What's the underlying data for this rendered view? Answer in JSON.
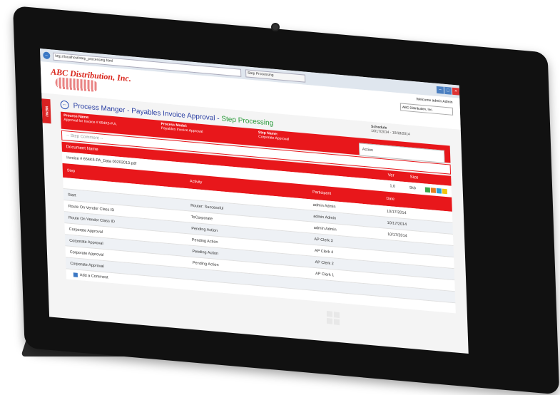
{
  "browser": {
    "address": "http://localhost/step_processing.html",
    "tab_title": "Step Processing",
    "back_icon": "back-arrow-icon"
  },
  "app": {
    "logo_text": "ABC Distribution, Inc.",
    "welcome": "Welcome admin Admin",
    "company_select": "ABC Distribution, Inc.",
    "menu_label": "MENU"
  },
  "page": {
    "title_main": "Process Manger - Payables Invoice Approval - ",
    "title_sub": "Step Processing",
    "schedule_label": "Schedule",
    "schedule_value": "10/17/2014 - 10/18/2014"
  },
  "process": {
    "name_label": "Process Name:",
    "name_value": "Approval for Invoice # 654K5-P.A.",
    "model_label": "Process Model:",
    "model_value": "Payables Invoice Approval",
    "step_label": "Step Name:",
    "step_value": "Corporate Approval",
    "action_placeholder": "Action",
    "comment_placeholder": "-- Step Comment --"
  },
  "documents": {
    "header": "Document Name",
    "ver_label": "Ver",
    "size_label": "Size",
    "file": "Invoice # 654K5-PA_Data 00202013.pdf",
    "ver": "1.0",
    "size": "5kb"
  },
  "steps": {
    "headers": [
      "Step",
      "Activity",
      "Participant",
      "Date"
    ],
    "rows": [
      [
        "",
        "",
        "admin Admin",
        "10/17/2014"
      ],
      [
        "Start",
        "Router: Successful",
        "admin Admin",
        "10/17/2014"
      ],
      [
        "Route On Vendor Class ID",
        "ToCorporate",
        "admin Admin",
        "10/17/2014"
      ],
      [
        "Route On Vendor Class ID",
        "Pending Action",
        "AP Clerk 3",
        ""
      ],
      [
        "Corporate Approval",
        "Pending Action",
        "AP Clerk 4",
        ""
      ],
      [
        "Corporate Approval",
        "Pending Action",
        "AP Clerk 2",
        ""
      ],
      [
        "Corporate Approval",
        "Pending Action",
        "AP Clerk 1",
        ""
      ],
      [
        "Corporate Approval",
        "",
        "",
        ""
      ]
    ],
    "add_comment": "Add a Comment"
  },
  "colors": {
    "accent": "#e8171b",
    "title_blue": "#2a3fa3",
    "title_green": "#2a9a3a"
  }
}
